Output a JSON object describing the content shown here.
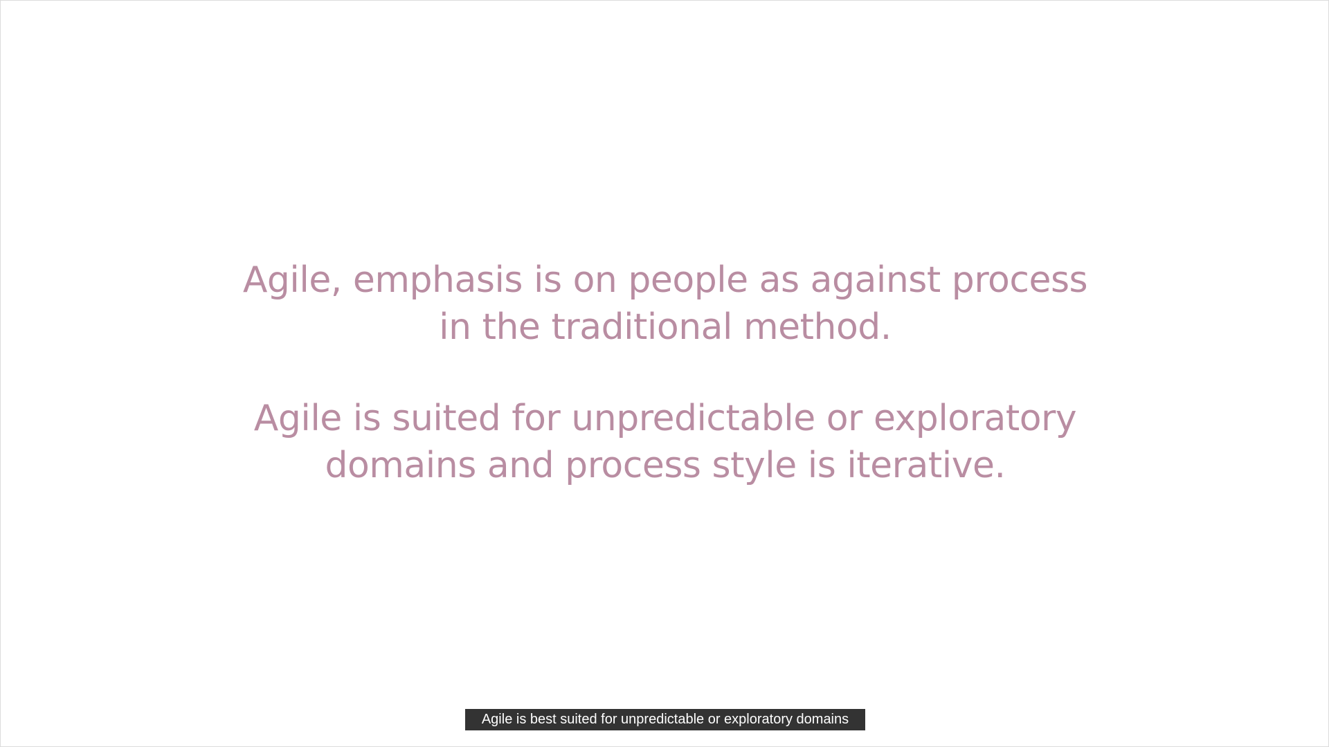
{
  "slide": {
    "paragraph1": {
      "line1": "Agile, emphasis is on people as against process",
      "line2": "in the traditional method."
    },
    "paragraph2": {
      "line1": "Agile is suited for unpredictable or exploratory",
      "line2": "domains and process style is iterative."
    }
  },
  "caption": {
    "text": "Agile is best suited for unpredictable or exploratory domains"
  },
  "colors": {
    "slide_text": "#b98da2",
    "caption_background": "#333333",
    "caption_text": "#ffffff",
    "background": "#ffffff"
  }
}
